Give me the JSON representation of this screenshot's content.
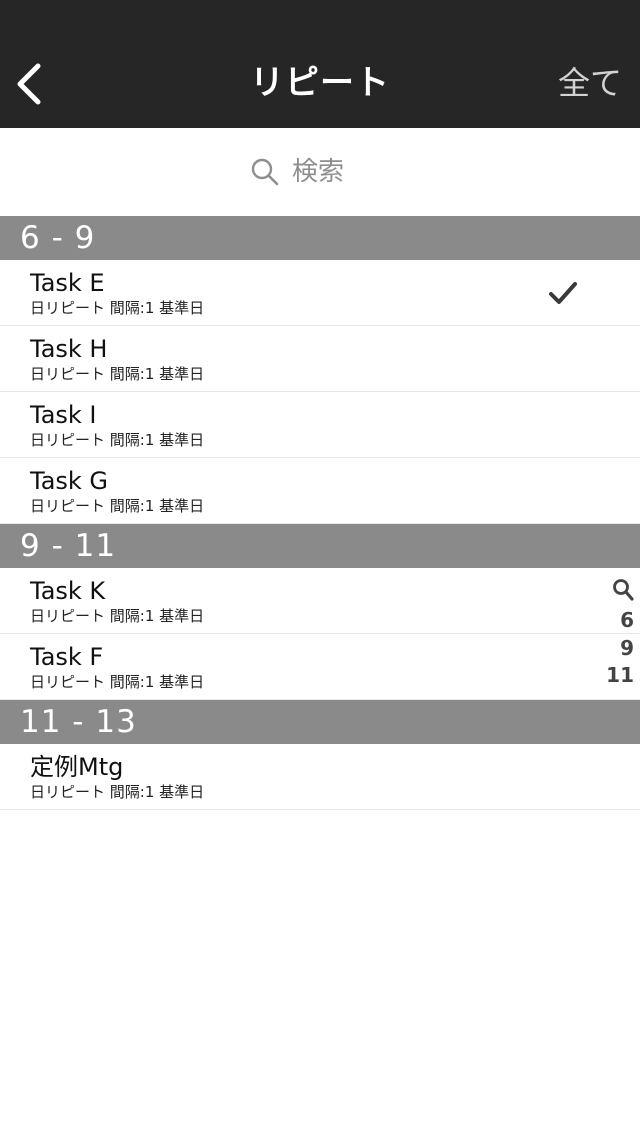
{
  "nav": {
    "title": "リピート",
    "right_label": "全て",
    "back_icon": "chevron-left-icon"
  },
  "search": {
    "placeholder": "検索",
    "icon": "search-icon"
  },
  "sections": [
    {
      "title": "6 - 9",
      "rows": [
        {
          "title": "Task E",
          "subtitle": "日リピート 間隔:1 基準日",
          "checked": true
        },
        {
          "title": "Task H",
          "subtitle": "日リピート 間隔:1 基準日",
          "checked": false
        },
        {
          "title": "Task I",
          "subtitle": "日リピート 間隔:1 基準日",
          "checked": false
        },
        {
          "title": "Task G",
          "subtitle": "日リピート 間隔:1 基準日",
          "checked": false
        }
      ]
    },
    {
      "title": "9 - 11",
      "rows": [
        {
          "title": "Task K",
          "subtitle": "日リピート 間隔:1 基準日",
          "checked": false
        },
        {
          "title": "Task F",
          "subtitle": "日リピート 間隔:1 基準日",
          "checked": false
        }
      ]
    },
    {
      "title": "11 - 13",
      "rows": [
        {
          "title": "定例Mtg",
          "subtitle": "日リピート 間隔:1 基準日",
          "checked": false
        }
      ]
    }
  ],
  "index_bar": {
    "icon": "search-icon",
    "items": [
      "6",
      "9",
      "11"
    ]
  },
  "colors": {
    "navbar": "#262626",
    "section_header": "#8a8a8a",
    "nav_right": "#d2d2d2"
  }
}
